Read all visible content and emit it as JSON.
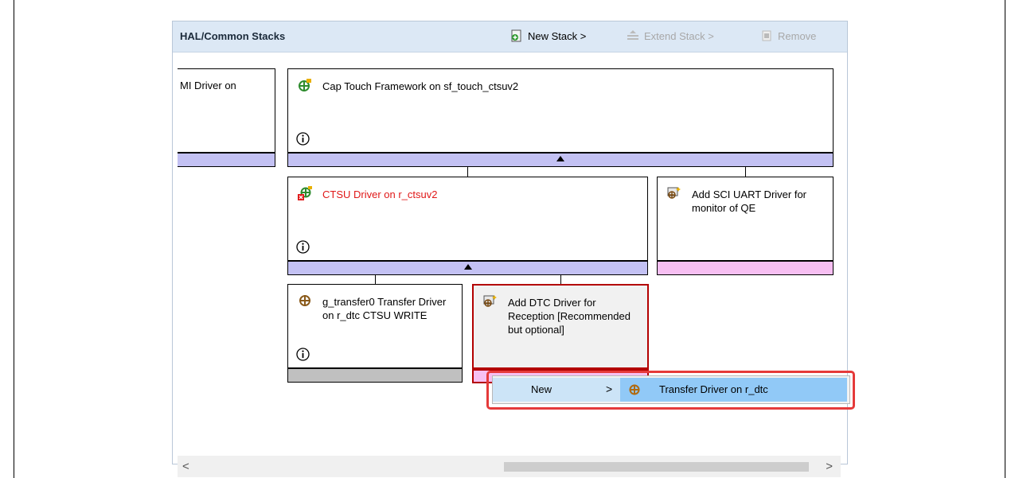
{
  "panel": {
    "title": "HAL/Common Stacks",
    "toolbar": {
      "new_stack": "New Stack >",
      "extend_stack": "Extend Stack >",
      "remove": "Remove"
    }
  },
  "blocks": {
    "left_partial": {
      "label": "MI Driver on"
    },
    "cap_touch": {
      "label": "Cap Touch Framework on sf_touch_ctsuv2"
    },
    "ctsu": {
      "label": "CTSU Driver on r_ctsuv2",
      "status_color": "#e01818"
    },
    "add_sci": {
      "label": "Add SCI UART Driver for monitor of QE"
    },
    "transfer0": {
      "label": "g_transfer0 Transfer Driver on r_dtc CTSU WRITE"
    },
    "add_dtc": {
      "label": "Add DTC Driver for Reception [Recommended but optional]"
    }
  },
  "context_menu": {
    "new_label": "New",
    "submenu_arrow": ">",
    "item_label": "Transfer Driver on r_dtc"
  },
  "scrollbar": {
    "left_arrow": "<",
    "right_arrow": ">"
  },
  "colors": {
    "accent_bar": "#c3c1f3",
    "pink_bar": "#f7bff2",
    "highlight": "#e53a3a",
    "menu_selected": "#91c9f7"
  }
}
